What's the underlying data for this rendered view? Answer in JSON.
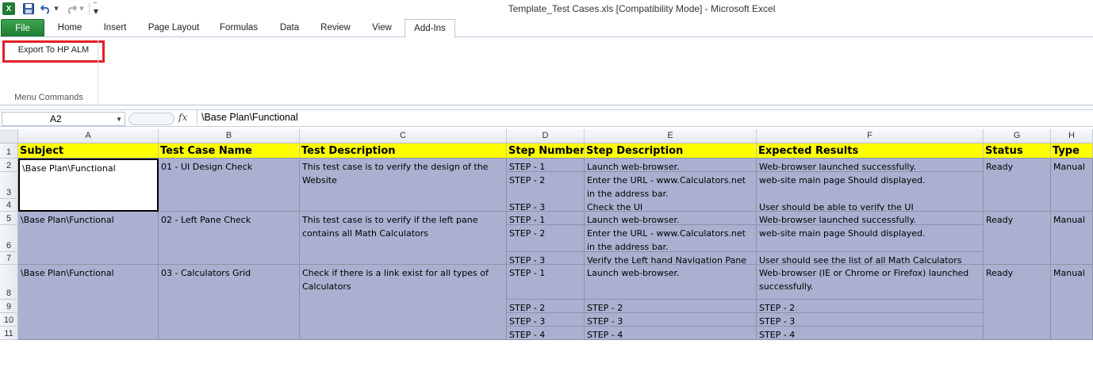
{
  "window": {
    "title": "Template_Test Cases.xls  [Compatibility Mode]  -  Microsoft Excel"
  },
  "qat_icons": [
    "excel-app-icon",
    "save-icon",
    "undo-icon",
    "redo-icon",
    "customize-qat-icon"
  ],
  "tabs": [
    {
      "label": "File"
    },
    {
      "label": "Home"
    },
    {
      "label": "Insert"
    },
    {
      "label": "Page Layout"
    },
    {
      "label": "Formulas"
    },
    {
      "label": "Data"
    },
    {
      "label": "Review"
    },
    {
      "label": "View"
    },
    {
      "label": "Add-Ins"
    }
  ],
  "ribbon": {
    "export_label": "Export To HP ALM",
    "group_label": "Menu Commands",
    "highlight_color": "#e21f26"
  },
  "formula_bar": {
    "name_box": "A2",
    "fx": "fx",
    "value": "\\Base Plan\\Functional"
  },
  "columns": [
    "A",
    "B",
    "C",
    "D",
    "E",
    "F",
    "G",
    "H"
  ],
  "rows": [
    "1",
    "2",
    "3",
    "4",
    "5",
    "6",
    "7",
    "8",
    "9",
    "10",
    "11"
  ],
  "headers": [
    "Subject",
    "Test Case Name",
    "Test Description",
    "Step Number",
    "Step Description",
    "Expected Results",
    "Status",
    "Type"
  ],
  "test_cases": [
    {
      "subject": "\\Base Plan\\Functional",
      "name": "01 - UI Design Check",
      "description": "This test case is to verify the design of the Website",
      "status": "Ready",
      "type": "Manual",
      "steps": [
        {
          "num": "STEP - 1",
          "desc": "Launch web-browser.",
          "expected": "Web-browser launched successfully."
        },
        {
          "num": "STEP - 2",
          "desc": "Enter the URL - www.Calculators.net in the address bar.",
          "expected": "web-site main page Should displayed."
        },
        {
          "num": "STEP - 3",
          "desc": "Check the UI",
          "expected": "User should be able to verify the UI"
        }
      ]
    },
    {
      "subject": "\\Base Plan\\Functional",
      "name": "02 - Left Pane Check",
      "description": "This test case is to verify if the left pane contains all Math Calculators",
      "status": "Ready",
      "type": "Manual",
      "steps": [
        {
          "num": "STEP - 1",
          "desc": "Launch web-browser.",
          "expected": "Web-browser launched successfully."
        },
        {
          "num": "STEP - 2",
          "desc": "Enter the URL - www.Calculators.net in the address bar.",
          "expected": "web-site main page Should displayed."
        },
        {
          "num": "STEP - 3",
          "desc": "Verify the Left hand Navigation Pane",
          "expected": "User should see the list of all Math Calculators displayed as link."
        }
      ]
    },
    {
      "subject": "\\Base Plan\\Functional",
      "name": "03 - Calculators Grid",
      "description": "Check if there is a link exist for all types of Calculators",
      "status": "Ready",
      "type": "Manual",
      "steps": [
        {
          "num": "STEP - 1",
          "desc": "Launch web-browser.",
          "expected": "Web-browser (IE or Chrome or Firefox) launched successfully."
        },
        {
          "num": "STEP - 2",
          "desc": "STEP - 2",
          "expected": "STEP - 2"
        },
        {
          "num": "STEP - 3",
          "desc": "STEP - 3",
          "expected": "STEP - 3"
        },
        {
          "num": "STEP - 4",
          "desc": "STEP - 4",
          "expected": "STEP - 4"
        }
      ]
    }
  ]
}
